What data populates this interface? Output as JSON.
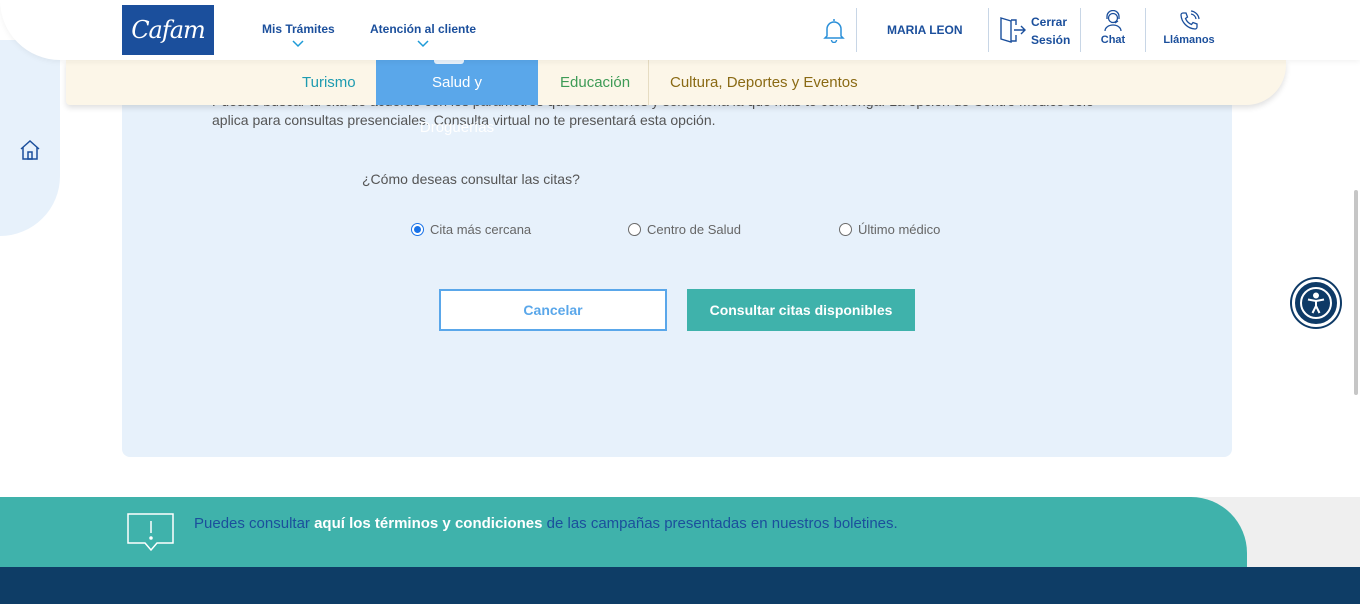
{
  "header": {
    "logo_text": "Cafam",
    "nav": [
      {
        "label": "Mis Trámites"
      },
      {
        "label": "Atención al cliente"
      }
    ],
    "user_name": "MARIA LEON",
    "logout_line1": "Cerrar",
    "logout_line2": "Sesión",
    "chat_label": "Chat",
    "call_label": "Llámanos"
  },
  "categories": [
    {
      "label": "Turismo"
    },
    {
      "label": "Salud y Droguerías",
      "active": true
    },
    {
      "label": "Educación"
    },
    {
      "label": "Cultura, Deportes y Eventos"
    }
  ],
  "card": {
    "description_line1": "Puedes buscar tu cita de acuerdo con los parámetros que selecciones y selecciona la que más te convenga. La opción de Centro Médico solo",
    "description_line2": "aplica para consultas presenciales. Consulta virtual no te presentará esta opción.",
    "question": "¿Cómo deseas consultar las citas?",
    "options": [
      {
        "label": "Cita más cercana",
        "checked": true
      },
      {
        "label": "Centro de Salud",
        "checked": false
      },
      {
        "label": "Último médico",
        "checked": false
      }
    ],
    "cancel_label": "Cancelar",
    "consult_label": "Consultar citas disponibles"
  },
  "footer": {
    "terms_prefix": "Puedes consultar ",
    "terms_link": "aquí los términos y condiciones",
    "terms_suffix": " de las campañas presentadas en nuestros boletines."
  },
  "colors": {
    "brand_blue": "#1b4f9c",
    "active_tab": "#5aa7ea",
    "teal": "#3fb2ab",
    "footer_dark": "#0e3d66"
  }
}
